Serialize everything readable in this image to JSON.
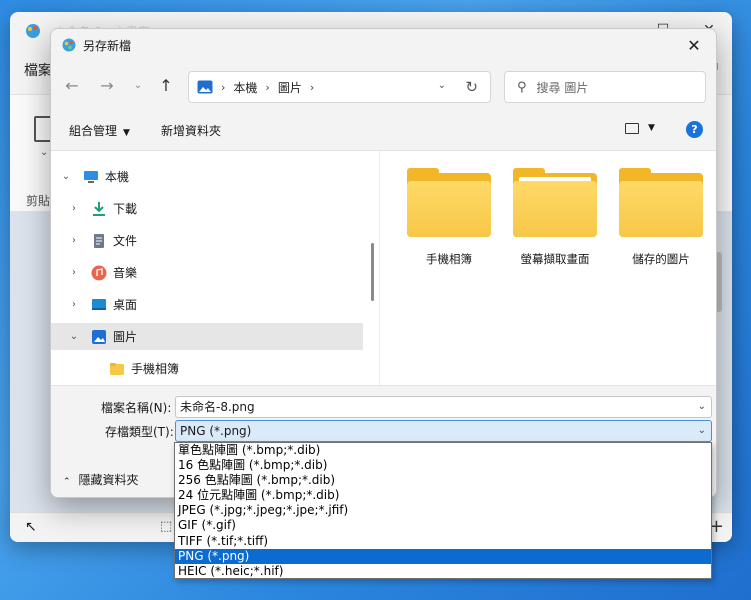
{
  "background_app": {
    "title": "未命名-8 - 小畫家",
    "menu_first": "檔案",
    "ribbon_group_label": "剪貼"
  },
  "dialog": {
    "title": "另存新檔",
    "address": [
      "本機",
      "圖片"
    ],
    "search_placeholder": "搜尋 圖片",
    "organize_label": "組合管理",
    "new_folder_label": "新增資料夾",
    "help_label": "?",
    "nav_tree": [
      {
        "label": "本機",
        "expanded": true,
        "icon": "computer-icon"
      },
      {
        "label": "下載",
        "expanded": false,
        "icon": "download-icon"
      },
      {
        "label": "文件",
        "expanded": false,
        "icon": "document-icon"
      },
      {
        "label": "音樂",
        "expanded": false,
        "icon": "music-icon"
      },
      {
        "label": "桌面",
        "expanded": false,
        "icon": "desktop-icon"
      },
      {
        "label": "圖片",
        "expanded": true,
        "selected": true,
        "icon": "pictures-icon"
      },
      {
        "label": "手機相簿",
        "icon": "folder-icon"
      }
    ],
    "folders": [
      "手機相簿",
      "螢幕擷取畫面",
      "儲存的圖片"
    ],
    "filename_label": "檔案名稱(N):",
    "filename_value": "未命名-8.png",
    "filetype_label": "存檔類型(T):",
    "filetype_value": "PNG (*.png)",
    "hide_folders_label": "隱藏資料夾",
    "filetype_options": [
      "單色點陣圖 (*.bmp;*.dib)",
      "16 色點陣圖 (*.bmp;*.dib)",
      "256 色點陣圖 (*.bmp;*.dib)",
      "24 位元點陣圖 (*.bmp;*.dib)",
      "JPEG (*.jpg;*.jpeg;*.jpe;*.jfif)",
      "GIF (*.gif)",
      "TIFF (*.tif;*.tiff)",
      "PNG (*.png)",
      "HEIC (*.heic;*.hif)"
    ],
    "selected_option_index": 7
  },
  "colors": {
    "accent": "#0b6bd1",
    "folder": "#f7c748"
  }
}
